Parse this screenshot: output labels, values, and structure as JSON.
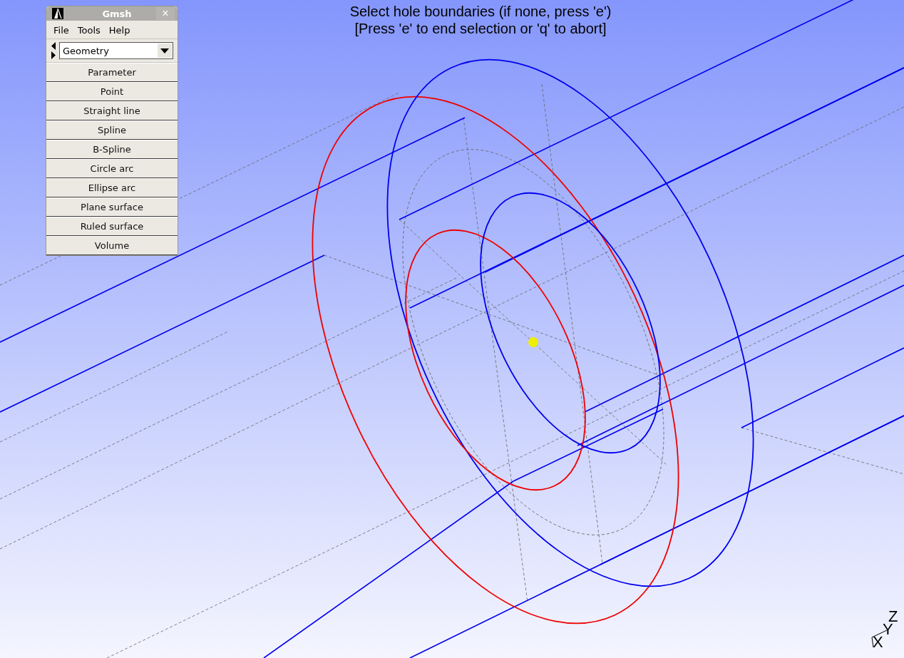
{
  "status_messages": [
    "Select hole boundaries (if none, press 'e')",
    "[Press 'e' to end selection or 'q' to abort]"
  ],
  "window": {
    "title": "Gmsh",
    "close": "×"
  },
  "menu": [
    {
      "label": "File"
    },
    {
      "label": "Tools"
    },
    {
      "label": "Help"
    }
  ],
  "module_select": {
    "value": "Geometry"
  },
  "buttons": [
    {
      "label": "Parameter"
    },
    {
      "label": "Point"
    },
    {
      "label": "Straight line"
    },
    {
      "label": "Spline"
    },
    {
      "label": "B-Spline"
    },
    {
      "label": "Circle arc"
    },
    {
      "label": "Ellipse arc"
    },
    {
      "label": "Plane surface"
    },
    {
      "label": "Ruled surface"
    },
    {
      "label": "Volume"
    }
  ],
  "axes": {
    "z": "Z",
    "y": "Y",
    "x": "X"
  }
}
